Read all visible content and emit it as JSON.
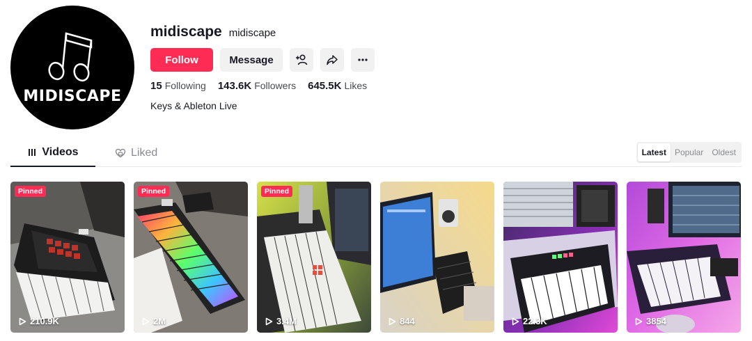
{
  "profile": {
    "avatar_text": "MIDISCAPE",
    "display_name": "midiscape",
    "handle": "midiscape",
    "bio": "Keys & Ableton Live"
  },
  "actions": {
    "follow_label": "Follow",
    "message_label": "Message",
    "add_friend_icon": "add-friend-icon",
    "share_icon": "share-icon",
    "more_icon": "more-icon"
  },
  "stats": {
    "following_count": "15",
    "following_label": "Following",
    "followers_count": "143.6K",
    "followers_label": "Followers",
    "likes_count": "645.5K",
    "likes_label": "Likes"
  },
  "tabs": {
    "videos": "Videos",
    "liked": "Liked"
  },
  "sort": {
    "options": [
      "Latest",
      "Popular",
      "Oldest"
    ],
    "selected": "Latest"
  },
  "colors": {
    "accent": "#fe2c55",
    "text": "#161823"
  },
  "videos": [
    {
      "pinned": true,
      "pinned_label": "Pinned",
      "views": "210.9K"
    },
    {
      "pinned": true,
      "pinned_label": "Pinned",
      "views": "2M"
    },
    {
      "pinned": true,
      "pinned_label": "Pinned",
      "views": "3.4M"
    },
    {
      "pinned": false,
      "views": "844"
    },
    {
      "pinned": false,
      "views": "22.3K"
    },
    {
      "pinned": false,
      "views": "3854"
    }
  ]
}
